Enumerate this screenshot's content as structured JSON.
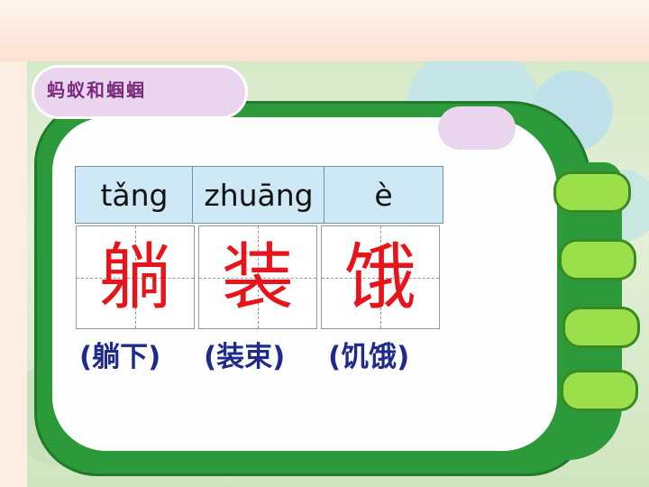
{
  "slide": {
    "title": "蚂蚁和蝈蝈"
  },
  "lesson": {
    "items": [
      {
        "pinyin": "tǎng",
        "character": "躺",
        "word": "(躺下)"
      },
      {
        "pinyin": "zhuāng",
        "character": "装",
        "word": "(装束)"
      },
      {
        "pinyin": "è",
        "character": "饿",
        "word": "(饥饿)"
      }
    ]
  },
  "colors": {
    "frame": "#2c9a3a",
    "character": "#e8141c",
    "word": "#1e2b8c",
    "pinyin_bg": "#cfe8f6",
    "pill": "#9be04a"
  }
}
